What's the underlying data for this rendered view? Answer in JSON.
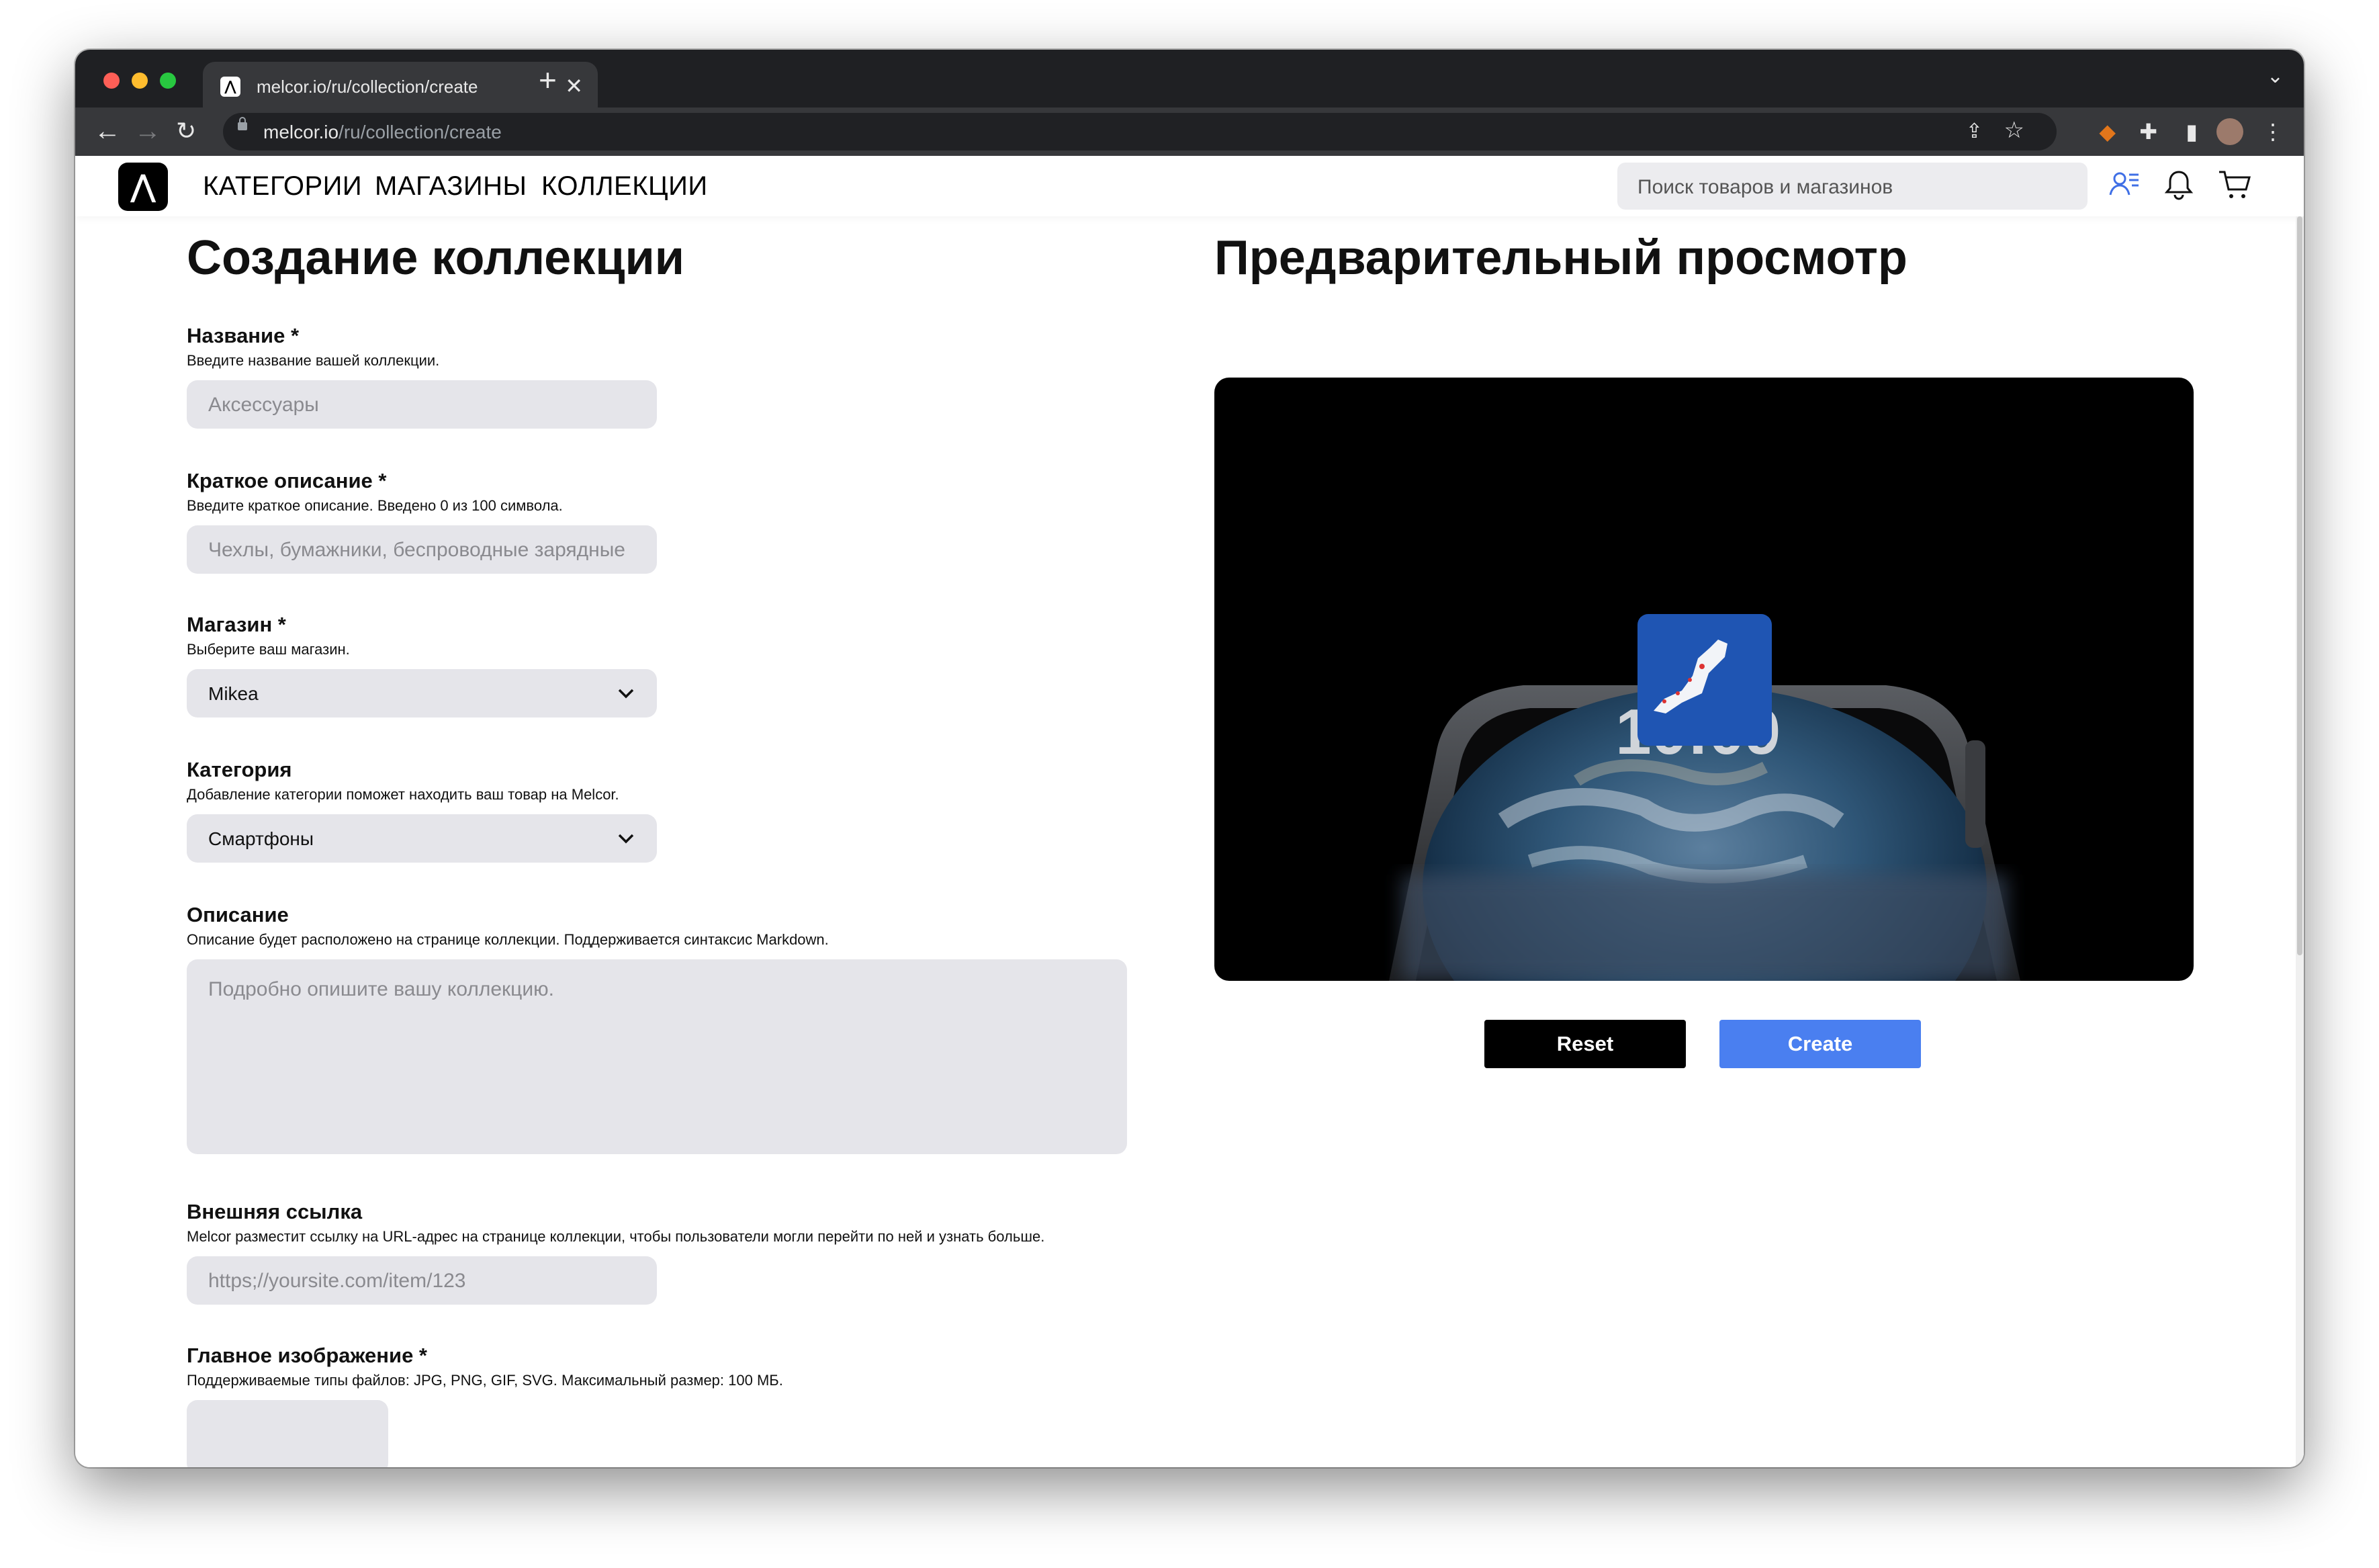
{
  "browser": {
    "tab_title": "melcor.io/ru/collection/create",
    "tab_favicon": "melcor-logo-icon",
    "url_host": "melcor.io",
    "url_path": "/ru/collection/create"
  },
  "header": {
    "logo": "melcor-logo",
    "nav": [
      "КАТЕГОРИИ",
      "МАГАЗИНЫ",
      "КОЛЛЕКЦИИ"
    ],
    "search_placeholder": "Поиск товаров и магазинов",
    "icons": [
      "user-list-icon",
      "bell-icon",
      "cart-icon"
    ],
    "accent_color": "#3f6fe6"
  },
  "form": {
    "title": "Создание коллекции",
    "name": {
      "label": "Название *",
      "hint": "Введите название вашей коллекции.",
      "placeholder": "Аксессуары"
    },
    "short_desc": {
      "label": "Краткое описание *",
      "hint": "Введите краткое описание. Введено 0 из 100 символа.",
      "placeholder": "Чехлы, бумажники, беспроводные зарядные"
    },
    "store": {
      "label": "Магазин *",
      "hint": "Выберите ваш магазин.",
      "value": "Mikea"
    },
    "category": {
      "label": "Категория",
      "hint": "Добавление категории поможет находить ваш товар на Melcor.",
      "value": "Смартфоны"
    },
    "description": {
      "label": "Описание",
      "hint": "Описание будет расположено на странице коллекции. Поддерживается синтаксис Markdown.",
      "placeholder": "Подробно опишите вашу коллекцию."
    },
    "link": {
      "label": "Внешняя ссылка",
      "hint": "Melcor разместит ссылку на URL-адрес на странице коллекции, чтобы пользователи могли перейти по ней и узнать больше.",
      "placeholder": "https;//yoursite.com/item/123"
    },
    "main_image": {
      "label": "Главное изображение *",
      "hint": "Поддерживаемые типы файлов: JPG, PNG, GIF, SVG. Максимальный размер: 100 МБ."
    }
  },
  "preview": {
    "title": "Предварительный просмотр",
    "watch_time": "10:09",
    "reset_label": "Reset",
    "create_label": "Create",
    "reset_color": "#000000",
    "create_color": "#4a7ff0"
  }
}
